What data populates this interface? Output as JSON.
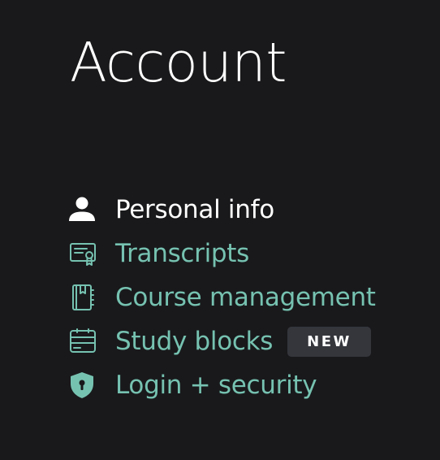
{
  "page": {
    "title": "Account"
  },
  "colors": {
    "background": "#19191b",
    "active_text": "#ffffff",
    "link_text": "#76c2b1",
    "badge_bg": "#34363c"
  },
  "nav": {
    "items": [
      {
        "label": "Personal info",
        "icon": "person-icon",
        "active": true
      },
      {
        "label": "Transcripts",
        "icon": "certificate-icon",
        "active": false
      },
      {
        "label": "Course management",
        "icon": "notebook-icon",
        "active": false
      },
      {
        "label": "Study blocks",
        "icon": "card-icon",
        "active": false,
        "badge": "NEW"
      },
      {
        "label": "Login + security",
        "icon": "shield-lock-icon",
        "active": false
      }
    ]
  }
}
